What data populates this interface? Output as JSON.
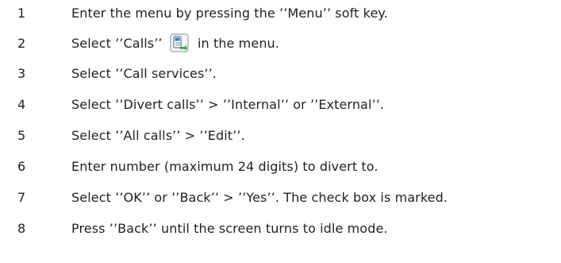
{
  "steps": [
    {
      "num": "1",
      "text": "Enter the menu by pressing the ’’Menu’’ soft key."
    },
    {
      "num": "2",
      "text_before": "Select ’’Calls’’",
      "icon": "calls-menu-icon",
      "text_after": "in the menu."
    },
    {
      "num": "3",
      "text": "Select ’’Call services’’."
    },
    {
      "num": "4",
      "text": "Select ’’Divert calls’’ > ’’Internal’’ or ’’External’’."
    },
    {
      "num": "5",
      "text": "Select ’’All calls’’ > ’’Edit’’."
    },
    {
      "num": "6",
      "text": "Enter number (maximum 24 digits) to divert to."
    },
    {
      "num": "7",
      "text": "Select ’’OK’’ or ’’Back’’ > ’’Yes’’. The check box is marked."
    },
    {
      "num": "8",
      "text": "Press ’’Back’’ until the screen turns to idle mode."
    }
  ],
  "colors": {
    "text": "#222222",
    "icon_frame": "#9aa3ad",
    "icon_accent": "#2f80d0",
    "icon_arrow": "#3aa03a"
  }
}
